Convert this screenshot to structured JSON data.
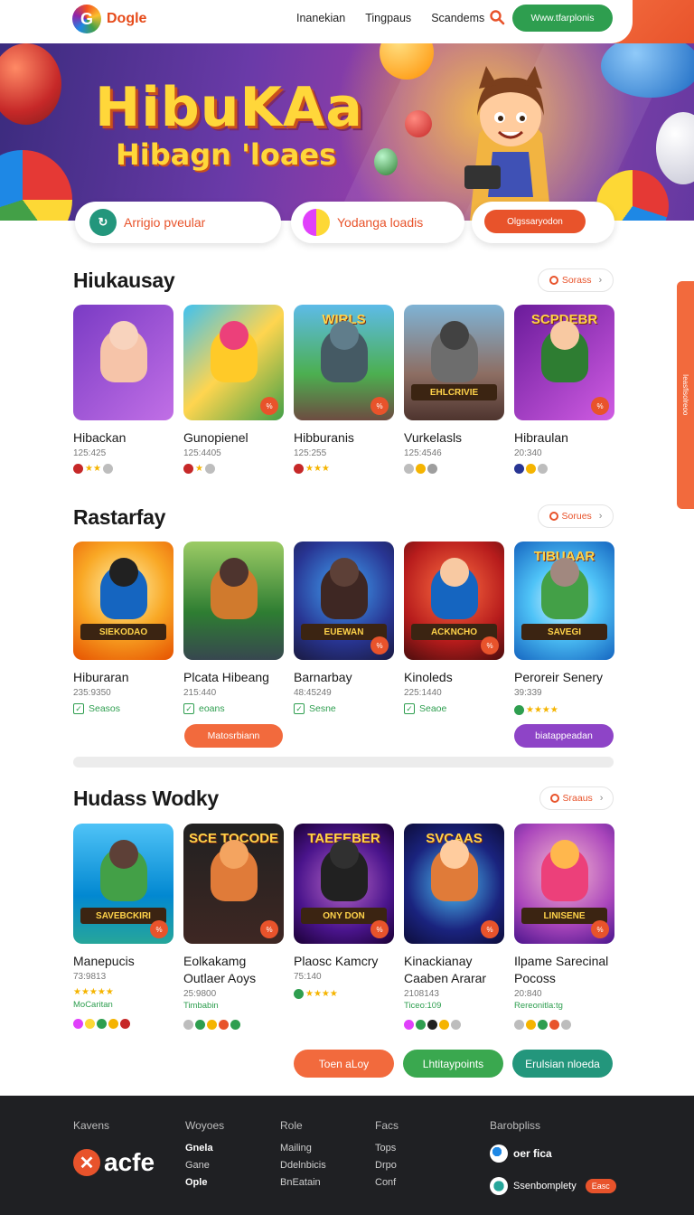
{
  "header": {
    "logo_text": "Dogle",
    "nav": [
      "Inanekian",
      "Tingpaus",
      "Scandems"
    ],
    "cta_label": "Www.tfarplonis"
  },
  "hero": {
    "title": "HibuKAa",
    "subtitle": "Hibagn 'loaes",
    "pills": [
      {
        "label": "Arrigio pveular"
      },
      {
        "label": "Yodanga loadis"
      },
      {
        "label": "Olgssaryodon"
      }
    ]
  },
  "side_tab": {
    "label": "Ieasfisolreoo"
  },
  "sections": [
    {
      "title": "Hiukausay",
      "more_label": "Sorass",
      "cards": [
        {
          "title": "Hibackan",
          "num": "125:425",
          "thumb_text": "",
          "banner": ""
        },
        {
          "title": "Gunopienel",
          "num": "125:4405",
          "thumb_text": "",
          "banner": ""
        },
        {
          "title": "Hibburanis",
          "num": "125:255",
          "thumb_text": "WIRLS",
          "banner": ""
        },
        {
          "title": "Vurkelasls",
          "num": "125:4546",
          "thumb_text": "",
          "banner": "EHLCRIVIE"
        },
        {
          "title": "Hibraulan",
          "num": "20:340",
          "thumb_text": "SCPDEBR",
          "banner": ""
        }
      ]
    },
    {
      "title": "Rastarfay",
      "more_label": "Sorues",
      "cards": [
        {
          "title": "Hiburaran",
          "num": "235:9350",
          "check": "Seasos",
          "banner": "SIEKODAO"
        },
        {
          "title": "Plcata Hibeang",
          "num": "215:440",
          "check": "eoans",
          "banner": ""
        },
        {
          "title": "Barnarbay",
          "num": "48:45249",
          "check": "Sesne",
          "banner": "EUEWAN"
        },
        {
          "title": "Kinoleds",
          "num": "225:1440",
          "check": "Seaoe",
          "banner": "ACKNCHO"
        },
        {
          "title": "Peroreir Senery",
          "num": "39:339",
          "check": "",
          "thumb_text": "TIBUAAR",
          "banner": "SAVEGI"
        }
      ],
      "buttons": [
        "Matosrbiann",
        "biatappeadan"
      ]
    },
    {
      "title": "Hudass Wodky",
      "more_label": "Sraaus",
      "cards": [
        {
          "title": "Manepucis",
          "num": "73:9813",
          "tag": "MoCaritan",
          "banner": "SAVEBCKIRI"
        },
        {
          "title": "Eolkakamg Outlaer Aoys",
          "num": "25:9800",
          "tag": "Timbabin",
          "thumb_text": "SCE TOCODE"
        },
        {
          "title": "Plaosc Kamcry",
          "num": "75:140",
          "tag": "",
          "thumb_text": "TAEEEBER",
          "banner": "ONY DON"
        },
        {
          "title": "Kinackianay Caaben Ararar",
          "num": "2108143",
          "tag": "Ticeo:109",
          "thumb_text": "SVCAAS"
        },
        {
          "title": "Ilpame Sarecinal Pocoss",
          "num": "20:840",
          "tag": "Rereonitla:tg",
          "banner": "LINISENE"
        }
      ]
    }
  ],
  "bottom_buttons": [
    "Toen aLoy",
    "Lhtitaypoints",
    "Erulsian nloeda"
  ],
  "footer": {
    "col1_head": "Kavens",
    "logo_text": "acfe",
    "col2": {
      "head": "Woyoes",
      "items": [
        "Gnela",
        "Gane",
        "Ople"
      ]
    },
    "col3": {
      "head": "Role",
      "items": [
        "Mailing",
        "Ddelnbicis",
        "BnEatain"
      ]
    },
    "col4": {
      "head": "Facs",
      "items": [
        "Tops",
        "Drpo",
        "Conf"
      ]
    },
    "col5": {
      "head": "Barobpliss",
      "brand1": "oer fica",
      "brand2": "Ssenbomplety",
      "chip": "Easc"
    }
  },
  "colors": {
    "accent": "#e8532b",
    "green": "#2e9e4f",
    "purple": "#8e44c7",
    "teal": "#23967c"
  }
}
